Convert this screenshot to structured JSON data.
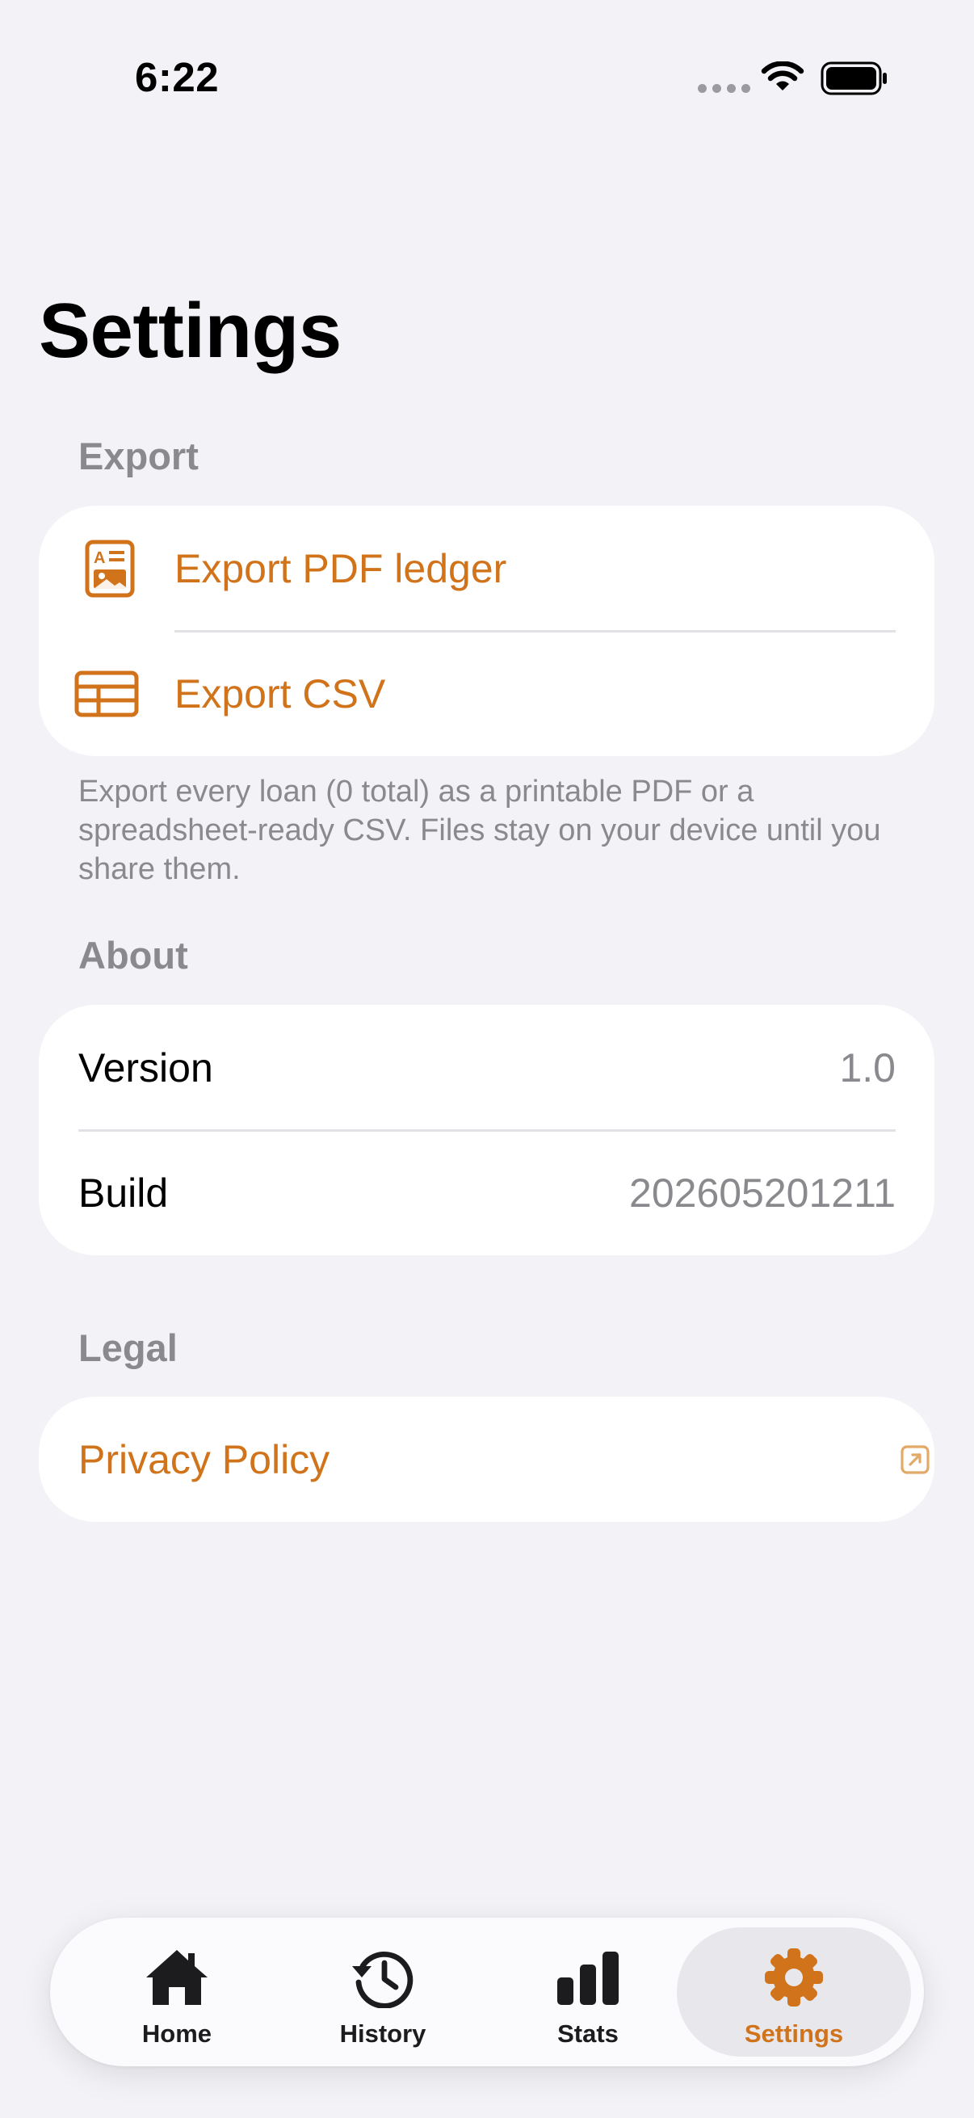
{
  "status_bar": {
    "time": "6:22"
  },
  "page": {
    "title": "Settings"
  },
  "sections": {
    "export": {
      "header": "Export",
      "items": [
        {
          "label": "Export PDF ledger",
          "icon": "pdf-document-icon"
        },
        {
          "label": "Export CSV",
          "icon": "table-icon"
        }
      ],
      "footer": "Export every loan (0 total) as a printable PDF or a spreadsheet-ready CSV. Files stay on your device until you share them."
    },
    "about": {
      "header": "About",
      "items": [
        {
          "label": "Version",
          "value": "1.0"
        },
        {
          "label": "Build",
          "value": "202605201211"
        }
      ]
    },
    "legal": {
      "header": "Legal",
      "items": [
        {
          "label": "Privacy Policy",
          "icon": "external-link-icon"
        }
      ]
    }
  },
  "tab_bar": {
    "tabs": [
      {
        "label": "Home",
        "icon": "house-icon"
      },
      {
        "label": "History",
        "icon": "clock-arrow-icon"
      },
      {
        "label": "Stats",
        "icon": "bar-chart-icon"
      },
      {
        "label": "Settings",
        "icon": "gear-icon",
        "active": true
      }
    ]
  },
  "colors": {
    "accent": "#d1731a",
    "background": "#f2f2f7",
    "secondary_text": "#8a8a8e"
  }
}
